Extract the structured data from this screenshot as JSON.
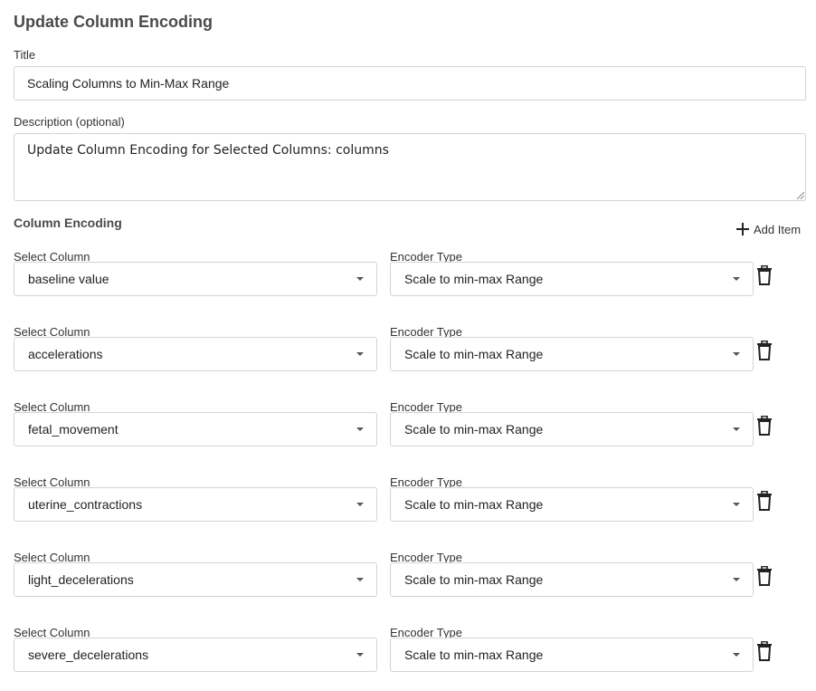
{
  "dialog": {
    "title": "Update Column Encoding"
  },
  "title_field": {
    "label": "Title",
    "value": "Scaling Columns to Min-Max Range"
  },
  "description_field": {
    "label": "Description (optional)",
    "value": "Update Column Encoding for Selected Columns: columns"
  },
  "encoding": {
    "section_title": "Column Encoding",
    "add_item_label": "Add Item",
    "column_label": "Select Column",
    "encoder_label": "Encoder Type",
    "items": [
      {
        "column": "baseline value",
        "encoder": "Scale to min-max Range"
      },
      {
        "column": "accelerations",
        "encoder": "Scale to min-max Range"
      },
      {
        "column": "fetal_movement",
        "encoder": "Scale to min-max Range"
      },
      {
        "column": "uterine_contractions",
        "encoder": "Scale to min-max Range"
      },
      {
        "column": "light_decelerations",
        "encoder": "Scale to min-max Range"
      },
      {
        "column": "severe_decelerations",
        "encoder": "Scale to min-max Range"
      }
    ]
  },
  "icons": {
    "add": "plus-icon",
    "delete": "trash-icon",
    "dropdown": "caret-down-icon"
  }
}
